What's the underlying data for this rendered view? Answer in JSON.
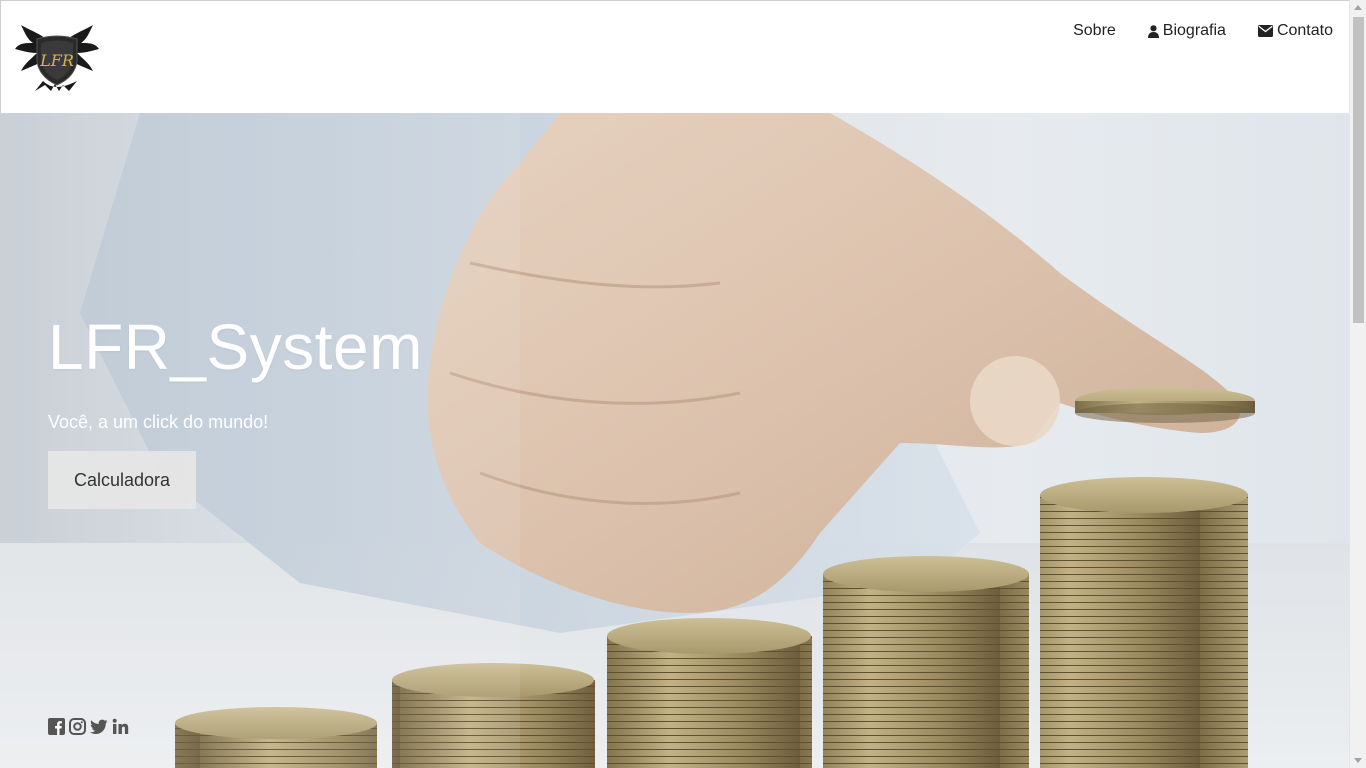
{
  "brand": {
    "logo_text": "LFR",
    "logo_icon": "winged-shield-logo"
  },
  "nav": {
    "items": [
      {
        "label": "Sobre",
        "icon": ""
      },
      {
        "label": "Biografia",
        "icon": "user-icon"
      },
      {
        "label": "Contato",
        "icon": "envelope-icon"
      }
    ]
  },
  "hero": {
    "title": "LFR_System",
    "subtitle": "Você, a um click do mundo!",
    "button_label": "Calculadora",
    "image": "hand-stacking-coins-photo"
  },
  "social": {
    "icons": [
      "facebook-icon",
      "instagram-icon",
      "twitter-icon",
      "linkedin-icon"
    ]
  },
  "colors": {
    "nav_text": "#222222",
    "hero_text": "#ffffff",
    "button_bg": "#e6e6e6",
    "social_icon": "#555555"
  }
}
